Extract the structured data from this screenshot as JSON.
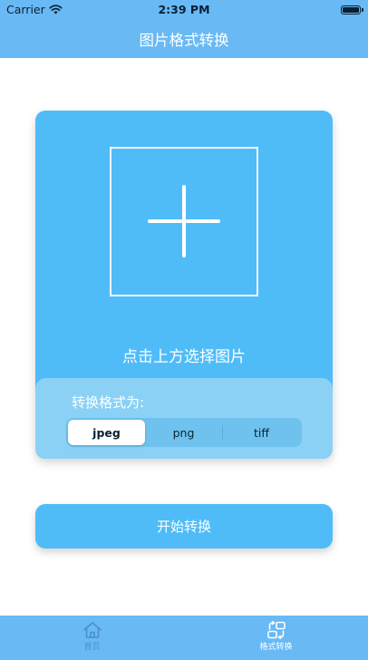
{
  "status_bar": {
    "carrier": "Carrier",
    "time": "2:39 PM"
  },
  "nav": {
    "title": "图片格式转换"
  },
  "picker": {
    "hint": "点击上方选择图片"
  },
  "format": {
    "label": "转换格式为:",
    "options": [
      "jpeg",
      "png",
      "tiff"
    ],
    "selected": "jpeg"
  },
  "actions": {
    "start_label": "开始转换"
  },
  "tabs": [
    {
      "label": "首页",
      "icon": "home-icon",
      "active": false
    },
    {
      "label": "格式转换",
      "icon": "convert-icon",
      "active": true
    }
  ],
  "colors": {
    "header": "#69b9f5",
    "card": "#4fbcf8",
    "panel": "#8bd1f6",
    "tab_inactive": "#4a90c8"
  }
}
